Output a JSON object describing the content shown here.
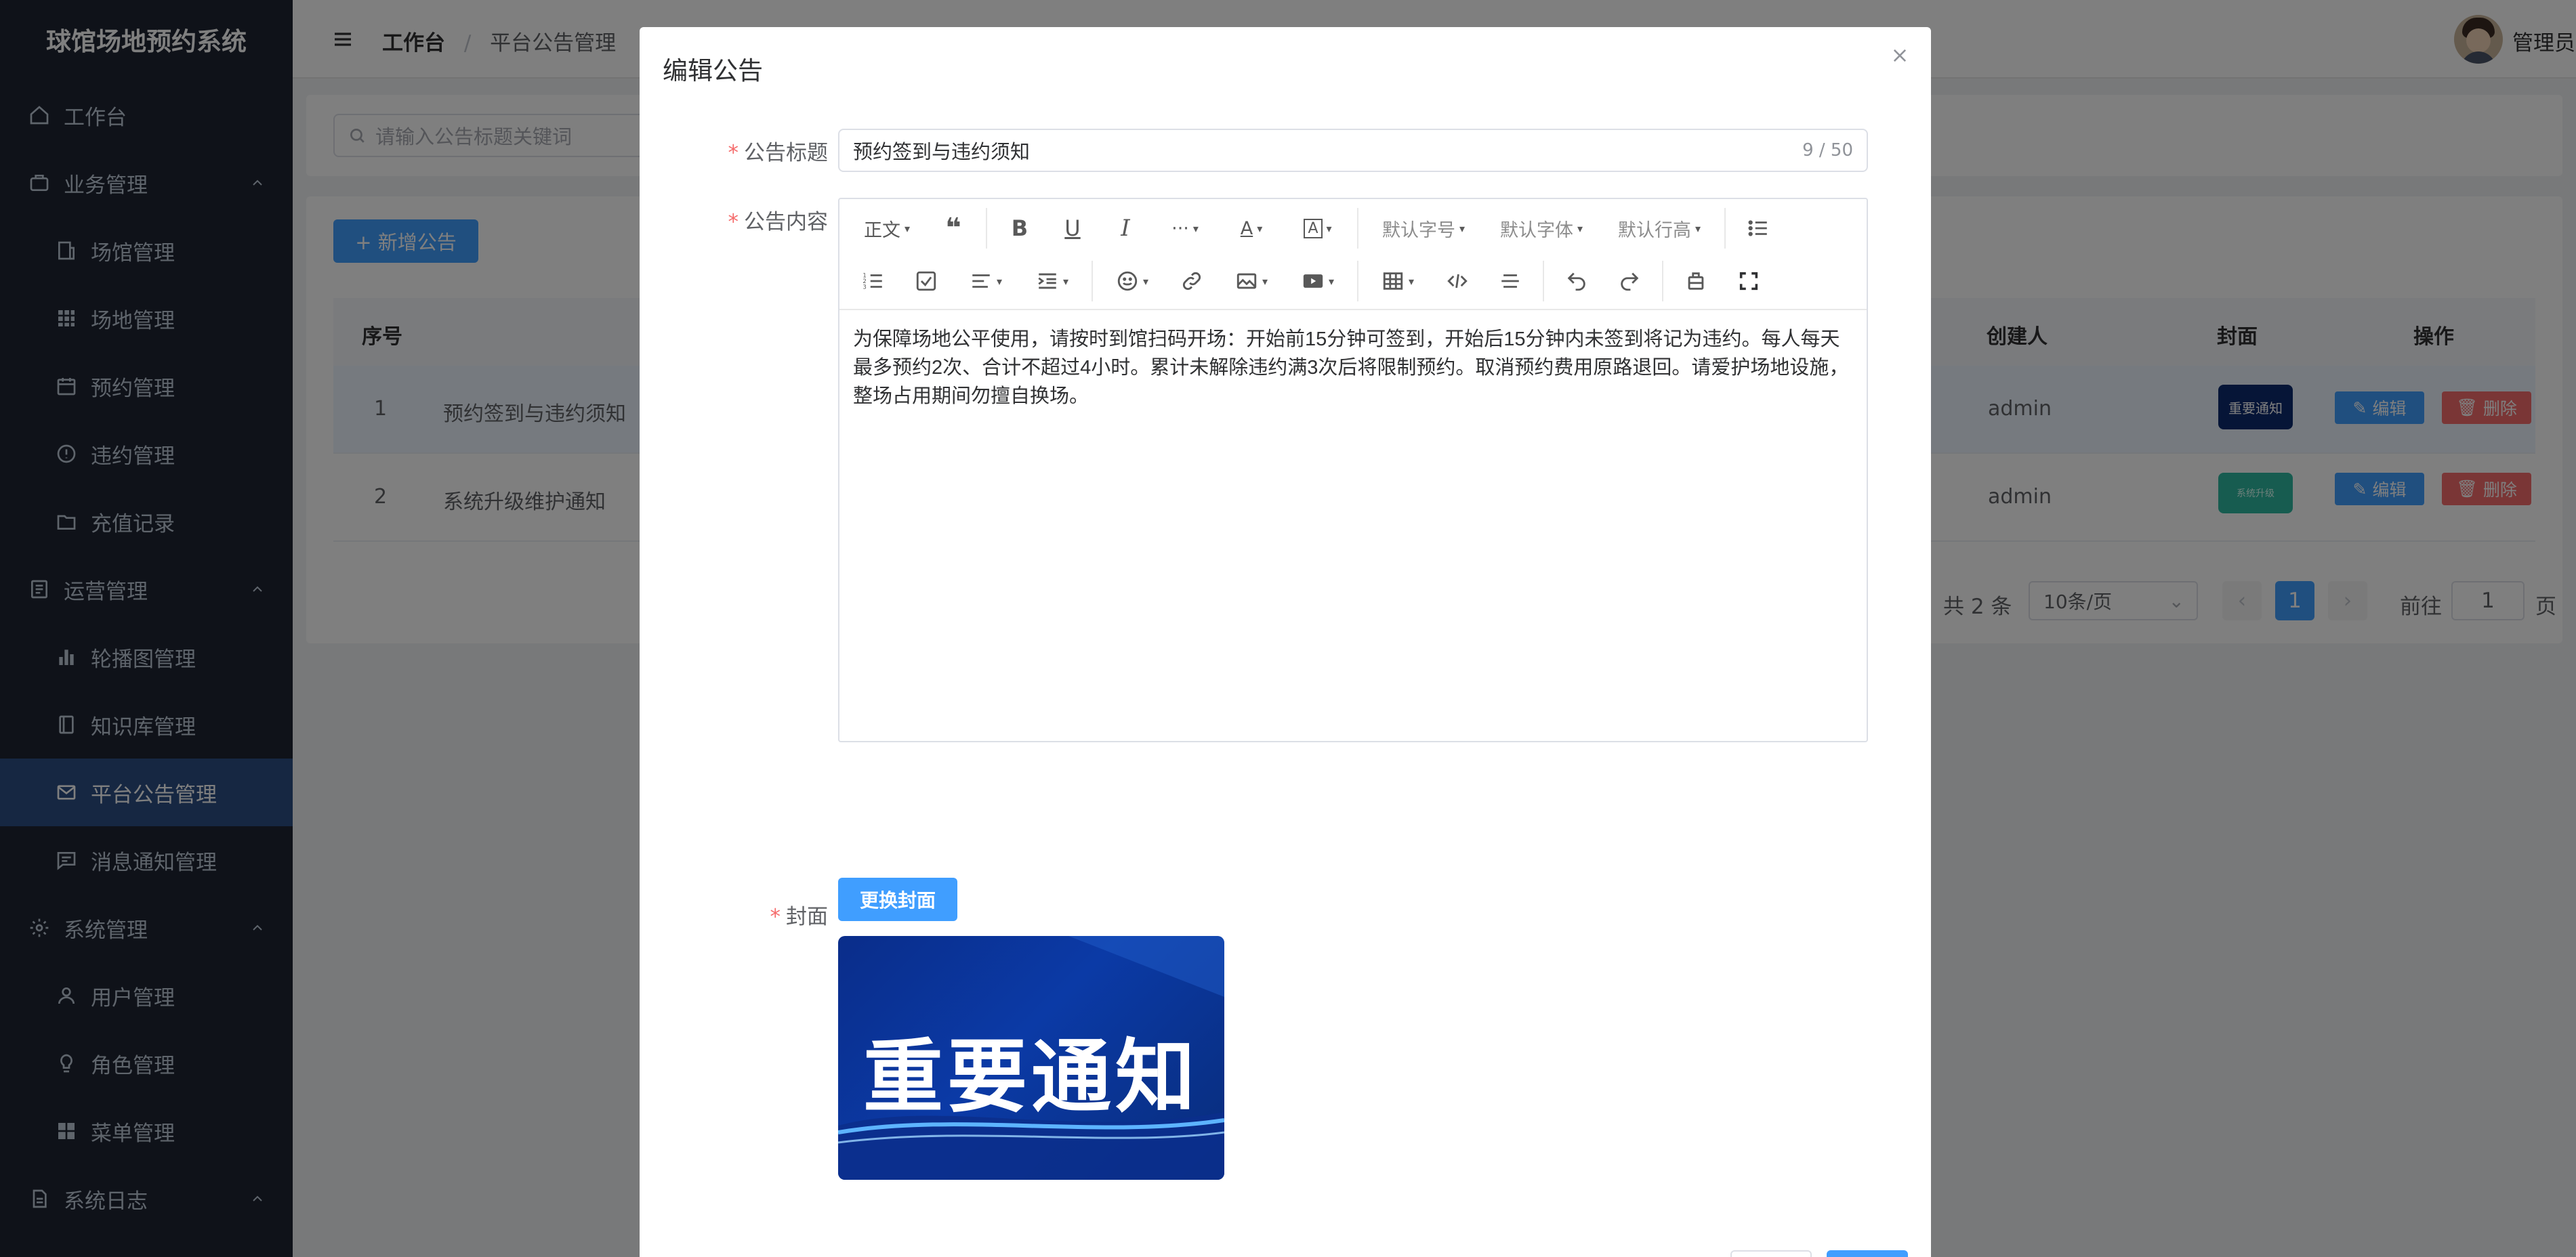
{
  "app": {
    "title": "球馆场地预约系统"
  },
  "sidebar": {
    "items": [
      {
        "label": "工作台",
        "icon": "home-icon"
      },
      {
        "label": "业务管理",
        "icon": "briefcase-icon"
      },
      {
        "label": "场馆管理",
        "icon": "building-icon"
      },
      {
        "label": "场地管理",
        "icon": "grid-icon"
      },
      {
        "label": "预约管理",
        "icon": "calendar-icon"
      },
      {
        "label": "违约管理",
        "icon": "alert-circle-icon"
      },
      {
        "label": "充值记录",
        "icon": "folder-icon"
      },
      {
        "label": "运营管理",
        "icon": "document-icon"
      },
      {
        "label": "轮播图管理",
        "icon": "bar-chart-icon"
      },
      {
        "label": "知识库管理",
        "icon": "book-icon"
      },
      {
        "label": "平台公告管理",
        "icon": "mail-icon"
      },
      {
        "label": "消息通知管理",
        "icon": "message-icon"
      },
      {
        "label": "系统管理",
        "icon": "gear-icon"
      },
      {
        "label": "用户管理",
        "icon": "user-icon"
      },
      {
        "label": "角色管理",
        "icon": "bulb-icon"
      },
      {
        "label": "菜单管理",
        "icon": "apps-icon"
      },
      {
        "label": "系统日志",
        "icon": "log-icon"
      }
    ]
  },
  "header": {
    "breadcrumb": [
      "工作台",
      "平台公告管理"
    ],
    "user": "管理员"
  },
  "toolbar": {
    "search_placeholder": "请输入公告标题关键词",
    "add_label": "+ 新增公告"
  },
  "table": {
    "columns": [
      "序号",
      "创建人",
      "封面",
      "操作"
    ],
    "rows": [
      {
        "index": "1",
        "title": "预约签到与违约须知",
        "creator": "admin",
        "cover_text": "重要通知"
      },
      {
        "index": "2",
        "title": "系统升级维护通知",
        "creator": "admin",
        "cover_text": "系统升级"
      }
    ],
    "edit_label": "编辑",
    "delete_label": "删除"
  },
  "pagination": {
    "total": "共 2 条",
    "page_size": "10条/页",
    "current": "1",
    "goto_label": "前往",
    "goto_value": "1",
    "page_suffix": "页"
  },
  "dialog": {
    "title": "编辑公告",
    "title_label": "公告标题",
    "title_value": "预约签到与违约须知",
    "title_count": "9 / 50",
    "content_label": "公告内容",
    "toolbar": {
      "heading": "正文",
      "font_size": "默认字号",
      "font_family": "默认字体",
      "line_height": "默认行高"
    },
    "content_text": "为保障场地公平使用，请按时到馆扫码开场：开始前15分钟可签到，开始后15分钟内未签到将记为违约。每人每天最多预约2次、合计不超过4小时。累计未解除违约满3次后将限制预约。取消预约费用原路退回。请爱护场地设施，整场占用期间勿擅自换场。",
    "cover_label": "封面",
    "change_cover": "更换封面",
    "cover_image_text": "重要通知"
  },
  "colors": {
    "sidebar_bg": "#1e2433",
    "sidebar_active": "#2c4e84",
    "primary": "#409eff",
    "danger": "#f56c6c"
  }
}
